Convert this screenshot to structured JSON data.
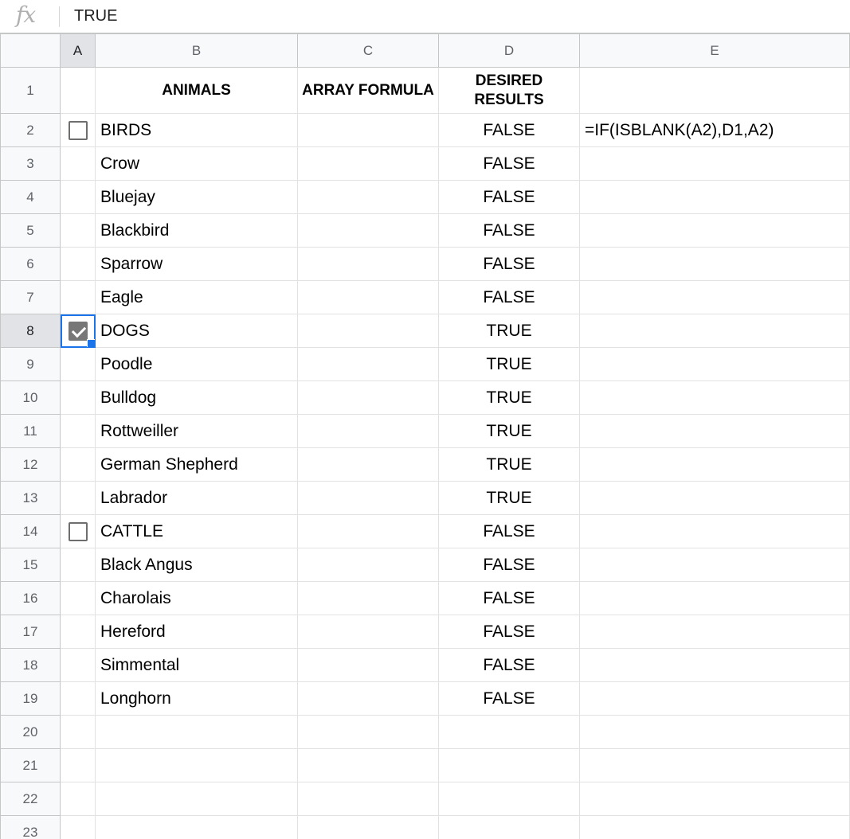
{
  "formula_bar": {
    "fx_label": "fx",
    "value": "TRUE"
  },
  "columns": [
    "A",
    "B",
    "C",
    "D",
    "E"
  ],
  "header_row": {
    "row": "1",
    "b": "ANIMALS",
    "c": "ARRAY FORMULA",
    "d": "DESIRED RESULTS"
  },
  "rows": [
    {
      "num": "2",
      "checkbox": "unchecked",
      "name": "BIRDS",
      "result": "FALSE",
      "formula": "=IF(ISBLANK(A2),D1,A2)"
    },
    {
      "num": "3",
      "checkbox": "",
      "name": "Crow",
      "result": "FALSE",
      "formula": ""
    },
    {
      "num": "4",
      "checkbox": "",
      "name": "Bluejay",
      "result": "FALSE",
      "formula": ""
    },
    {
      "num": "5",
      "checkbox": "",
      "name": "Blackbird",
      "result": "FALSE",
      "formula": ""
    },
    {
      "num": "6",
      "checkbox": "",
      "name": "Sparrow",
      "result": "FALSE",
      "formula": ""
    },
    {
      "num": "7",
      "checkbox": "",
      "name": "Eagle",
      "result": "FALSE",
      "formula": ""
    },
    {
      "num": "8",
      "checkbox": "checked",
      "name": "DOGS",
      "result": "TRUE",
      "formula": ""
    },
    {
      "num": "9",
      "checkbox": "",
      "name": "Poodle",
      "result": "TRUE",
      "formula": ""
    },
    {
      "num": "10",
      "checkbox": "",
      "name": "Bulldog",
      "result": "TRUE",
      "formula": ""
    },
    {
      "num": "11",
      "checkbox": "",
      "name": "Rottweiller",
      "result": "TRUE",
      "formula": ""
    },
    {
      "num": "12",
      "checkbox": "",
      "name": "German Shepherd",
      "result": "TRUE",
      "formula": ""
    },
    {
      "num": "13",
      "checkbox": "",
      "name": "Labrador",
      "result": "TRUE",
      "formula": ""
    },
    {
      "num": "14",
      "checkbox": "unchecked",
      "name": "CATTLE",
      "result": "FALSE",
      "formula": ""
    },
    {
      "num": "15",
      "checkbox": "",
      "name": "Black Angus",
      "result": "FALSE",
      "formula": ""
    },
    {
      "num": "16",
      "checkbox": "",
      "name": "Charolais",
      "result": "FALSE",
      "formula": ""
    },
    {
      "num": "17",
      "checkbox": "",
      "name": "Hereford",
      "result": "FALSE",
      "formula": ""
    },
    {
      "num": "18",
      "checkbox": "",
      "name": "Simmental",
      "result": "FALSE",
      "formula": ""
    },
    {
      "num": "19",
      "checkbox": "",
      "name": "Longhorn",
      "result": "FALSE",
      "formula": ""
    },
    {
      "num": "20",
      "checkbox": "",
      "name": "",
      "result": "",
      "formula": ""
    },
    {
      "num": "21",
      "checkbox": "",
      "name": "",
      "result": "",
      "formula": ""
    },
    {
      "num": "22",
      "checkbox": "",
      "name": "",
      "result": "",
      "formula": ""
    },
    {
      "num": "23",
      "checkbox": "",
      "name": "",
      "result": "",
      "formula": ""
    }
  ],
  "selection": {
    "cell": "A8",
    "color": "#1a73e8"
  }
}
